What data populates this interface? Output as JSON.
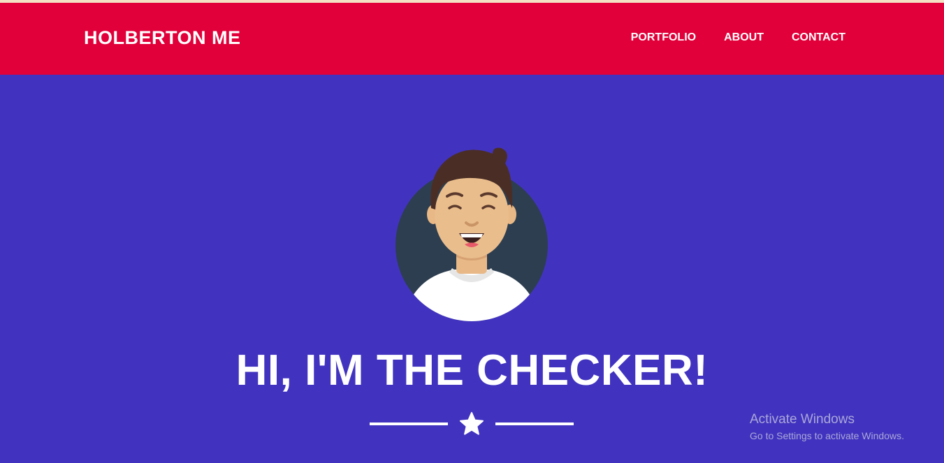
{
  "header": {
    "brand": "HOLBERTON ME",
    "nav": [
      {
        "label": "PORTFOLIO"
      },
      {
        "label": "ABOUT"
      },
      {
        "label": "CONTACT"
      }
    ]
  },
  "hero": {
    "title": "HI, I'M THE CHECKER!",
    "avatar_icon": "cartoon-avatar",
    "divider_icon": "star-icon"
  },
  "watermark": {
    "title": "Activate Windows",
    "subtitle": "Go to Settings to activate Windows."
  },
  "colors": {
    "header_bg": "#e10039",
    "hero_bg": "#4133bf",
    "text": "#ffffff"
  }
}
